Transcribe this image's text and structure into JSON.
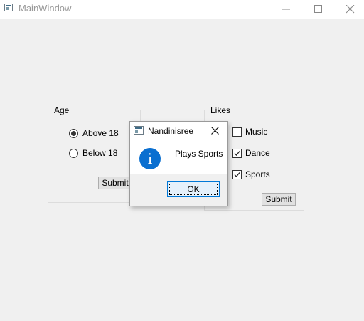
{
  "window": {
    "title": "MainWindow",
    "icon": "app-window-icon"
  },
  "age_group": {
    "title": "Age",
    "options": [
      {
        "label": "Above 18",
        "checked": true
      },
      {
        "label": "Below 18",
        "checked": false
      }
    ],
    "submit_label": "Submit"
  },
  "likes_group": {
    "title": "Likes",
    "options": [
      {
        "label": "Music",
        "checked": false
      },
      {
        "label": "Dance",
        "checked": true
      },
      {
        "label": "Sports",
        "checked": true
      }
    ],
    "submit_label": "Submit"
  },
  "dialog": {
    "title": "Nandinisree",
    "message": "Plays Sports",
    "icon": "info-icon",
    "ok_label": "OK"
  },
  "colors": {
    "info_icon": "#0a6fd0",
    "ok_focus_border": "#0078d7"
  }
}
